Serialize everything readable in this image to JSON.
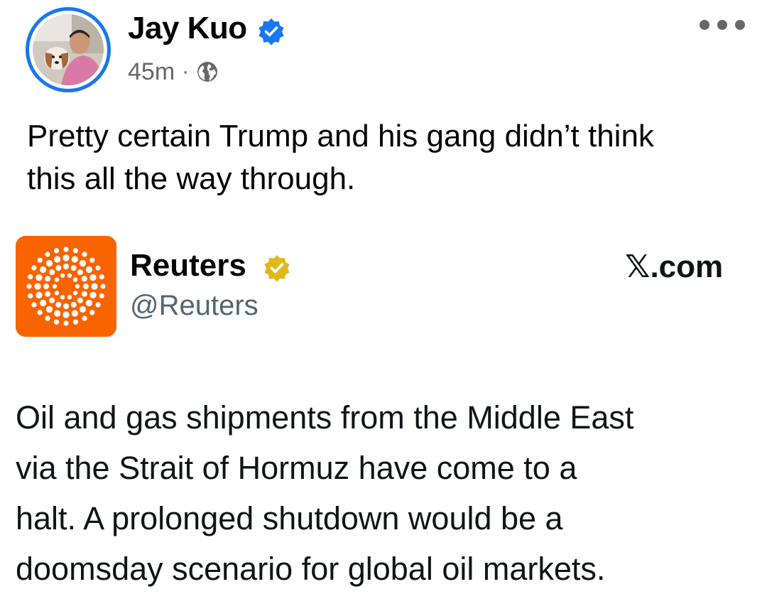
{
  "post": {
    "author_name": "Jay Kuo",
    "timestamp": "45m",
    "separator": "·",
    "visibility_icon": "globe-icon",
    "verified_icon": "verified-badge-icon",
    "more_icon": "more-options-icon",
    "text": "Pretty certain Trump and his gang didn’t think\nthis all the way through."
  },
  "embed": {
    "name": "Reuters",
    "handle": "@Reuters",
    "source": "𝕏.com",
    "verified_icon": "gold-verified-badge-icon",
    "text": "Oil and gas shipments from the Middle East\nvia the Strait of Hormuz have come to a\nhalt. A prolonged shutdown would be a\ndoomsday scenario for global oil markets."
  },
  "colors": {
    "facebook_blue": "#1877f2",
    "reuters_orange": "#fa6400",
    "gold_badge": "#e2b719",
    "meta_gray": "#65676b"
  }
}
